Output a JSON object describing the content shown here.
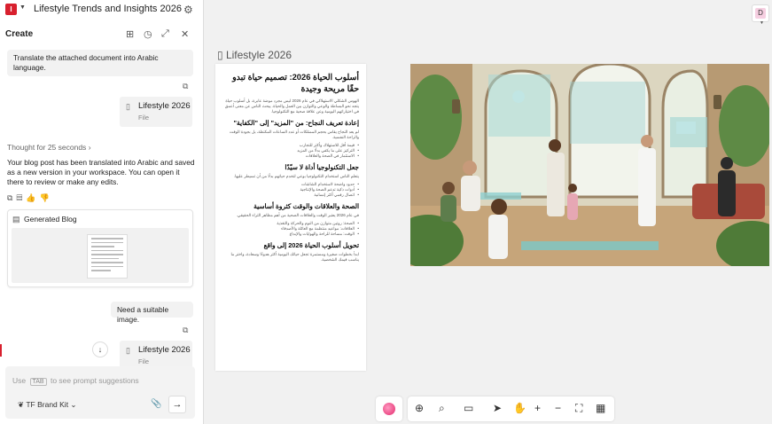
{
  "app": {
    "logo_letter": "I",
    "document_title": "Lifestyle Trends and Insights 2026"
  },
  "panel": {
    "heading": "Create"
  },
  "chat": {
    "user_message_1": "Translate the attached document into Arabic language.",
    "attachment_1": {
      "name": "Lifestyle 2026",
      "type": "File"
    },
    "thought": "Thought for 25 seconds",
    "assistant_reply": "Your blog post has been translated into Arabic and saved as a new version in your workspace. You can open it there to review or make any edits.",
    "generated_card_label": "Generated Blog",
    "user_message_2": "Need a suitable image.",
    "attachment_2": {
      "name": "Lifestyle 2026",
      "type": "File"
    }
  },
  "prompt": {
    "placeholder_before": "Use",
    "placeholder_key": "TAB",
    "placeholder_after": "to see prompt suggestions",
    "brand_kit": "TF Brand Kit"
  },
  "canvas": {
    "frame_label": "Lifestyle 2026",
    "user_initial": "D"
  },
  "article": {
    "title": "أسلوب الحياة 2026: تصميم حياة تبدو حقًا مريحة وجيدة",
    "intro": "الهوس الشكلي الاستهلاكي في عام 2026 ليس مجرد موضة عابرة، بل أسلوب حياة يتجه نحو البساطة والوعي والتوازن بين العمل والحياة. يبحث الناس عن معنى أعمق في اختياراتهم اليومية وعن علاقة صحية مع التكنولوجيا.",
    "sections": [
      {
        "heading": "إعادة تعريف النجاح: من \"المزيد\" إلى \"الكفاية\"",
        "body": "لم يعد النجاح يقاس بحجم الممتلكات أو عدد الساعات المكتظة، بل بجودة الوقت والراحة النفسية.",
        "bullets": [
          "قيمة أقل للاستهلاك وأكثر للتجارب",
          "التركيز على ما يكفي بدلًا من المزيد",
          "الاستثمار في الصحة والعلاقات"
        ]
      },
      {
        "heading": "جعل التكنولوجيا أداة لا سيّدًا",
        "body": "يتعلم الناس استخدام التكنولوجيا بوعي لتخدم حياتهم بدلًا من أن تسيطر عليها.",
        "bullets": [
          "حدود واضحة لاستخدام الشاشات",
          "أدوات ذكية تدعم الصحة والإنتاجية",
          "اتصال رقمي أكثر إنسانية"
        ]
      },
      {
        "heading": "الصحة والعلاقات والوقت كثروة أساسية",
        "body": "في عام 2026 يعتبر الوقت والعلاقات الصحية من أهم مظاهر الثراء الحقيقي.",
        "bullets": [
          "الصحة: روتين متوازن من النوم والحركة والتغذية",
          "العلاقات: مواعيد منتظمة مع العائلة والأصدقاء",
          "الوقت: مساحة للراحة والهوايات والإبداع"
        ]
      },
      {
        "heading": "تحويل أسلوب الحياة 2026 إلى واقع",
        "body": "ابدأ بخطوات صغيرة ومستمرة تجعل حياتك اليومية أكثر هدوءًا وسعادة، واختر ما يناسب قيمك الشخصية.",
        "bullets": []
      }
    ]
  }
}
